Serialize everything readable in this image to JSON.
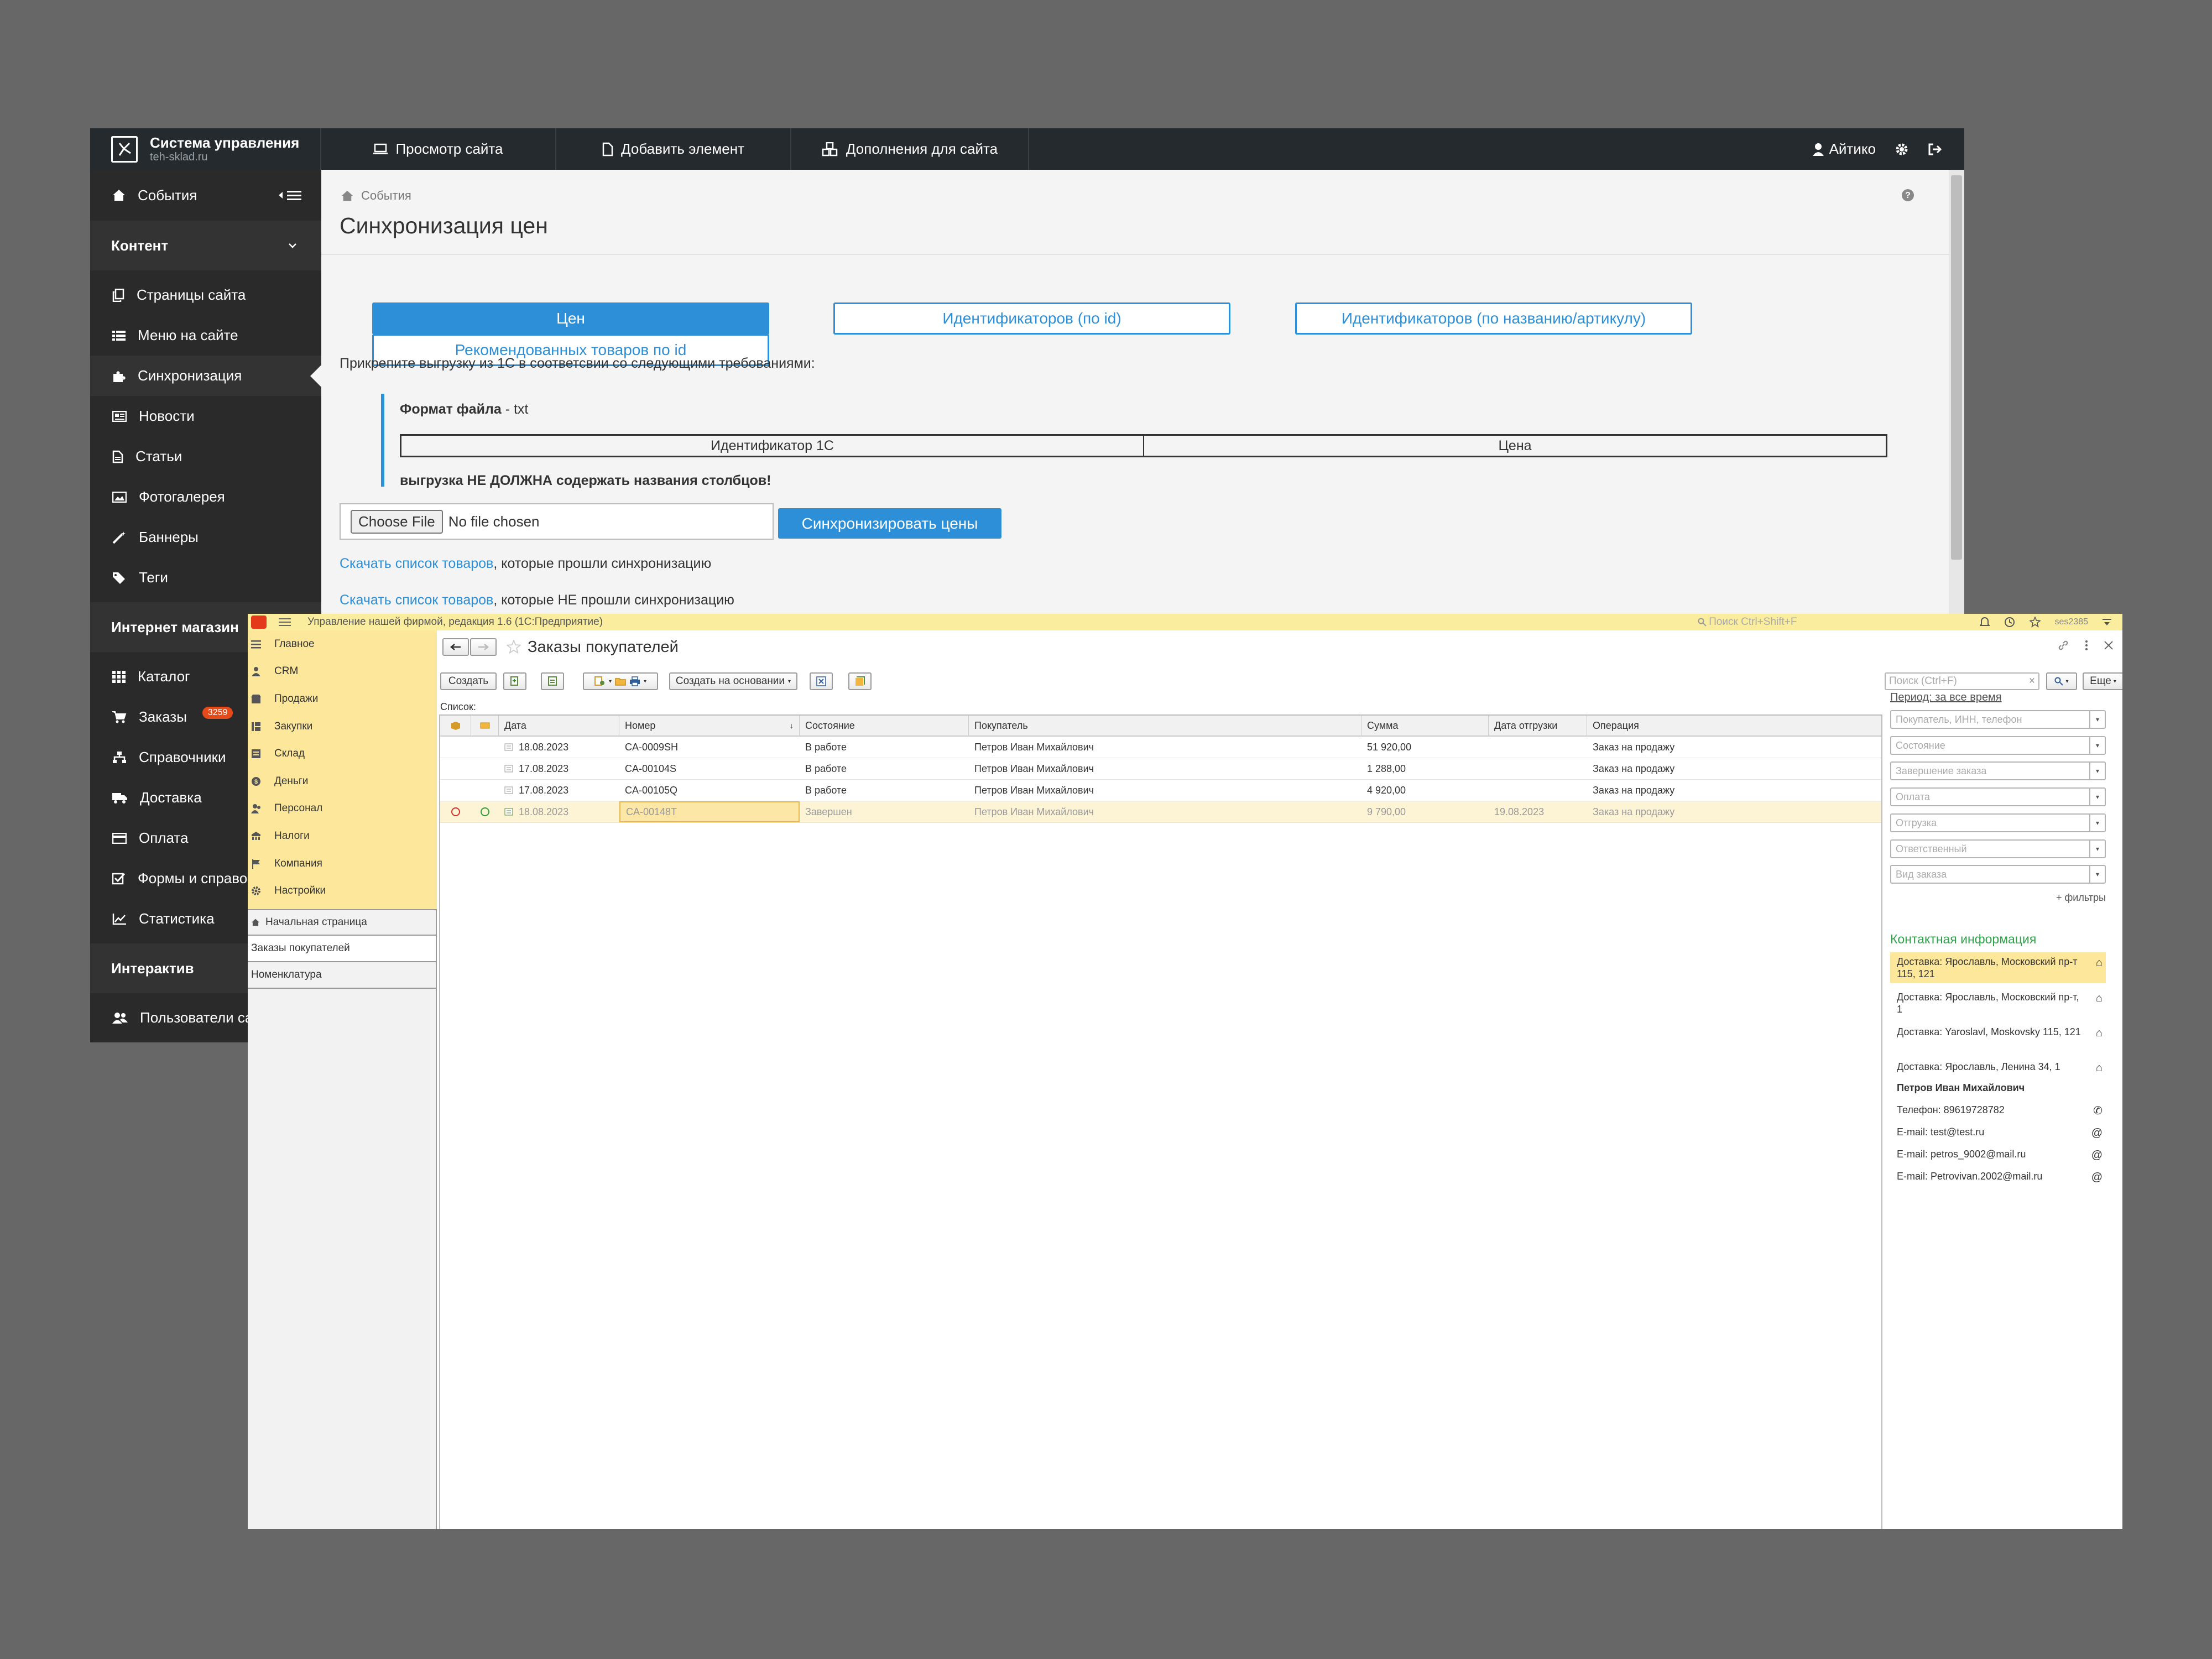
{
  "cms": {
    "logo_title": "Система управления",
    "logo_sub": "teh-sklad.ru",
    "top_nav": [
      {
        "label": "Просмотр сайта",
        "icon": "monitor-icon"
      },
      {
        "label": "Добавить элемент",
        "icon": "file-icon"
      },
      {
        "label": "Дополнения для сайта",
        "icon": "cubes-icon"
      }
    ],
    "user": "Айтико",
    "sidebar": {
      "events": "События",
      "content_section": "Контент",
      "content_items": [
        "Страницы сайта",
        "Меню на сайте",
        "Синхронизация",
        "Новости",
        "Статьи",
        "Фотогалерея",
        "Баннеры",
        "Теги"
      ],
      "shop_section": "Интернет магазин",
      "shop_items": [
        "Каталог",
        "Заказы",
        "Справочники",
        "Доставка",
        "Оплата",
        "Формы и справочники",
        "Статистика"
      ],
      "orders_badge": "3259",
      "interactive_section": "Интерактив",
      "interactive_items": [
        "Пользователи сайта"
      ]
    },
    "breadcrumb": "События",
    "page_title": "Синхронизация цен",
    "tabs": [
      "Цен",
      "Идентификаторов (по id)",
      "Идентификаторов (по названию/артикулу)",
      "Рекомендованных товаров по id"
    ],
    "hint": "Прикрепите выгрузку из 1С в соответсвии со следующими требованиями:",
    "format_label": "Формат файла",
    "format_value": " - txt",
    "columns": [
      "Идентификатор 1С",
      "Цена"
    ],
    "warning": "выгрузка НЕ ДОЛЖНА содержать названия столбцов!",
    "choose_file": "Choose File",
    "no_file": "No file chosen",
    "sync_button": "Синхронизировать цены",
    "download_link": "Скачать список товаров",
    "passed_text": ", которые прошли синхронизацию",
    "failed_text": ", которые НЕ прошли синхронизацию"
  },
  "onec": {
    "window_title": "Управление нашей фирмой, редакция 1.6  (1С:Предприятие)",
    "search_top": "Поиск Ctrl+Shift+F",
    "user_short": "ses2385",
    "nav": [
      "Главное",
      "CRM",
      "Продажи",
      "Закупки",
      "Склад",
      "Деньги",
      "Персонал",
      "Налоги",
      "Компания",
      "Настройки"
    ],
    "open_windows": [
      "Начальная страница",
      "Заказы покупателей",
      "Номенклатура"
    ],
    "title": "Заказы покупателей",
    "create_button": "Создать",
    "create_based_button": "Создать на основании",
    "search_placeholder": "Поиск (Ctrl+F)",
    "more_button": "Еще",
    "list_label": "Список:",
    "columns": [
      "Дата",
      "Номер",
      "Состояние",
      "Покупатель",
      "Сумма",
      "Дата отгрузки",
      "Операция"
    ],
    "rows": [
      {
        "date": "18.08.2023",
        "number": "CA-0009SH",
        "state": "В работе",
        "buyer": "Петров Иван Михайлович",
        "sum": "51 920,00",
        "ship": "",
        "op": "Заказ на продажу"
      },
      {
        "date": "17.08.2023",
        "number": "CA-00104S",
        "state": "В работе",
        "buyer": "Петров Иван Михайлович",
        "sum": "1 288,00",
        "ship": "",
        "op": "Заказ на продажу"
      },
      {
        "date": "17.08.2023",
        "number": "CA-00105Q",
        "state": "В работе",
        "buyer": "Петров Иван Михайлович",
        "sum": "4 920,00",
        "ship": "",
        "op": "Заказ на продажу"
      },
      {
        "date": "18.08.2023",
        "number": "CA-00148T",
        "state": "Завершен",
        "buyer": "Петров Иван Михайлович",
        "sum": "9 790,00",
        "ship": "19.08.2023",
        "op": "Заказ на продажу"
      }
    ],
    "period": "Период: за все время",
    "filters": [
      "Покупатель, ИНН, телефон",
      "Состояние",
      "Завершение заказа",
      "Оплата",
      "Отгрузка",
      "Ответственный",
      "Вид заказа"
    ],
    "more_filters": "+ фильтры",
    "contact_title": "Контактная информация",
    "contacts": [
      {
        "text": "Доставка: Ярославль, Московский пр-т 115, 121",
        "icon": "home-icon"
      },
      {
        "text": "Доставка: Ярославль, Московский пр-т, 1",
        "icon": "home-icon"
      },
      {
        "text": "Доставка: Yaroslavl, Moskovsky 115, 121",
        "icon": "home-icon"
      },
      {
        "text": "Доставка: Ярославль, Ленина 34, 1",
        "icon": "home-icon"
      }
    ],
    "contact_person": "Петров Иван Михайлович",
    "contact_details": [
      {
        "text": "Телефон: 89619728782",
        "icon": "phone-icon"
      },
      {
        "text": "E-mail: test@test.ru",
        "icon": "at-icon"
      },
      {
        "text": "E-mail: petros_9002@mail.ru",
        "icon": "at-icon"
      },
      {
        "text": "E-mail: Petrovivan.2002@mail.ru",
        "icon": "at-icon"
      }
    ]
  }
}
